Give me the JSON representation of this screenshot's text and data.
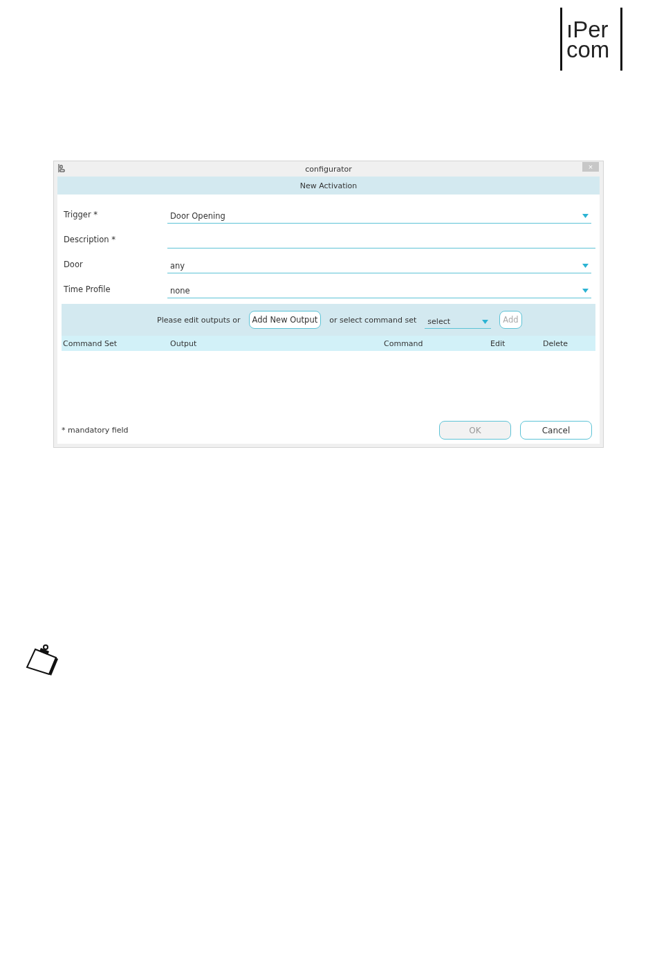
{
  "logo": {
    "lines": [
      "ıPer",
      "com"
    ]
  },
  "window": {
    "title": "configurator",
    "close": "×"
  },
  "dialog": {
    "title": "New Activation",
    "fields": [
      {
        "label": "Trigger *",
        "kind": "dropdown",
        "value": "Door Opening"
      },
      {
        "label": "Description *",
        "kind": "text"
      },
      {
        "label": "Door",
        "kind": "dropdown",
        "value": "any"
      },
      {
        "label": "Time Profile",
        "kind": "dropdown",
        "value": "none"
      }
    ],
    "outputs_bar": {
      "prompt": "Please edit outputs or",
      "add_output_button": "Add New Output",
      "or_text": "or select command set",
      "command_set": {
        "value": "select"
      },
      "add_button": {
        "label": "Add",
        "disabled": true
      }
    },
    "table": {
      "columns": [
        "Command Set",
        "Output",
        "Command",
        "Edit",
        "Delete"
      ]
    },
    "footnote": "* mandatory field",
    "buttons": [
      {
        "label": "OK",
        "disabled": true
      },
      {
        "label": "Cancel",
        "disabled": false
      }
    ]
  }
}
